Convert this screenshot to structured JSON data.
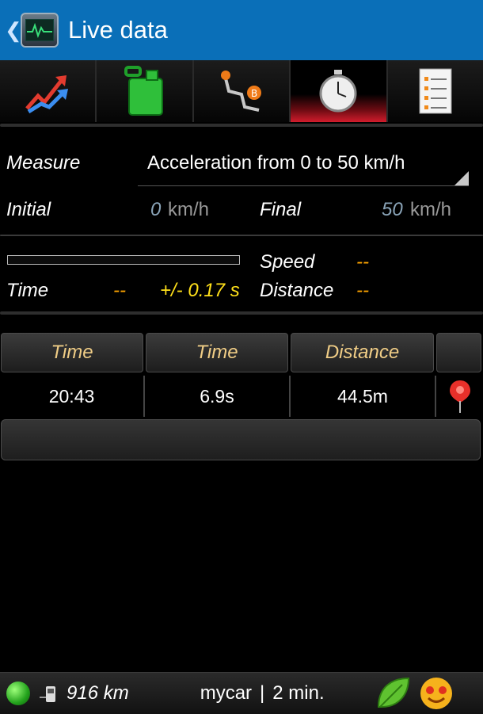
{
  "appbar": {
    "title": "Live data",
    "back_glyph": "❮",
    "icon": "monitor-icon"
  },
  "tabs": [
    {
      "icon": "trend-chart-icon",
      "active": false
    },
    {
      "icon": "fuel-can-icon",
      "active": false
    },
    {
      "icon": "route-icon",
      "active": false
    },
    {
      "icon": "stopwatch-icon",
      "active": true
    },
    {
      "icon": "checklist-icon",
      "active": false
    }
  ],
  "measure": {
    "label": "Measure",
    "value": "Acceleration from 0 to 50 km/h"
  },
  "initial": {
    "label": "Initial",
    "value": "0",
    "unit": "km/h"
  },
  "final": {
    "label": "Final",
    "value": "50",
    "unit": "km/h"
  },
  "progress": {
    "fraction": 0
  },
  "speed": {
    "label": "Speed",
    "value": "--"
  },
  "time": {
    "label": "Time",
    "value": "--",
    "accuracy": "+/- 0.17 s"
  },
  "distance": {
    "label": "Distance",
    "value": "--"
  },
  "table": {
    "headers": [
      "Time",
      "Time",
      "Distance",
      ""
    ],
    "rows": [
      {
        "time": "20:43",
        "duration": "6.9s",
        "distance": "44.5m",
        "icon": "map-pin-icon"
      }
    ]
  },
  "statusbar": {
    "status_icon": "green-status-dot",
    "odometer": "916 km",
    "car": "mycar",
    "separator": "|",
    "duration": "2 min.",
    "eco_icon": "leaf-icon",
    "mood_icon": "smiley-face-icon"
  },
  "colors": {
    "appbar": "#0a6fb8",
    "active_tab": "#d21c2c",
    "highlight": "#ffe01a",
    "placeholder": "#ffa500",
    "header_text": "#f0cd86"
  }
}
